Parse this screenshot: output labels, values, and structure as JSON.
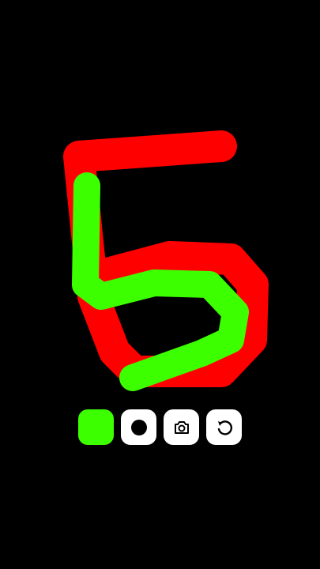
{
  "colors": {
    "background": "#000000",
    "stroke_red": "#ff0000",
    "stroke_green": "#3cff00",
    "button_background": "#ffffff",
    "icon": "#000000"
  },
  "drawing": {
    "strokes": [
      {
        "color": "red"
      },
      {
        "color": "green"
      }
    ]
  },
  "toolbar": {
    "items": [
      {
        "name": "color-picker-button",
        "icon": "green-swatch",
        "selected_color": "#3cff00"
      },
      {
        "name": "brush-size-button",
        "icon": "brush-dot-icon"
      },
      {
        "name": "camera-button",
        "icon": "camera-icon"
      },
      {
        "name": "undo-button",
        "icon": "undo-icon"
      }
    ]
  }
}
